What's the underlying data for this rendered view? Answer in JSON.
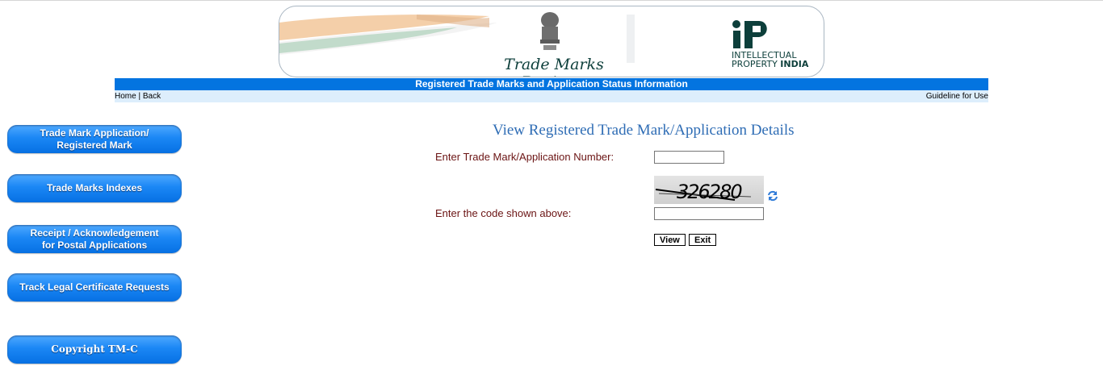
{
  "banner": {
    "title": "Trade Marks Registry",
    "ip_line1": "INTELLECTUAL",
    "ip_line2a": "PROPERTY ",
    "ip_line2b": "INDIA"
  },
  "strip": {
    "title": "Registered Trade Marks and Application Status Information"
  },
  "subnav": {
    "home": "Home",
    "sep": " | ",
    "back": "Back",
    "guideline": "Guideline for Use"
  },
  "sidebar": {
    "items": [
      {
        "label": "Trade Mark Application/\nRegistered Mark"
      },
      {
        "label": "Trade Marks Indexes"
      },
      {
        "label": "Receipt / Acknowledgement\nfor Postal Applications"
      },
      {
        "label": "Track Legal Certificate Requests"
      },
      {
        "label": "Copyright TM-C"
      }
    ]
  },
  "form": {
    "title": "View Registered Trade Mark/Application Details",
    "app_number_label": "Enter Trade Mark/Application Number:",
    "app_number_value": "",
    "captcha_text": "326280",
    "code_label": "Enter the code shown above:",
    "code_value": "",
    "view_button": "View",
    "exit_button": "Exit"
  },
  "colors": {
    "accent": "#0374e0",
    "label": "#6b1414",
    "title": "#2f6db5"
  }
}
